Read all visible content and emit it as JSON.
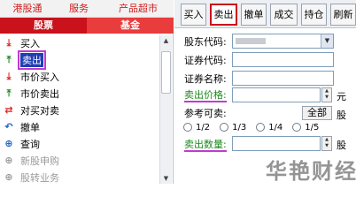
{
  "top_tabs": [
    "港股通",
    "服务",
    "产品超市"
  ],
  "market_tabs": [
    {
      "label": "股票",
      "active": true
    },
    {
      "label": "基金",
      "active": false
    }
  ],
  "menu": [
    {
      "label": "买入",
      "icon": "download-arrow-icon",
      "glyph": "⤓",
      "color": "red",
      "selected": false,
      "disabled": false
    },
    {
      "label": "卖出",
      "icon": "upload-arrow-icon",
      "glyph": "⤒",
      "color": "green",
      "selected": true,
      "disabled": false
    },
    {
      "label": "市价买入",
      "icon": "download-arrow-icon",
      "glyph": "⤓",
      "color": "red",
      "selected": false,
      "disabled": false
    },
    {
      "label": "市价卖出",
      "icon": "upload-arrow-icon",
      "glyph": "⤒",
      "color": "green",
      "selected": false,
      "disabled": false
    },
    {
      "label": "对买对卖",
      "icon": "swap-arrows-icon",
      "glyph": "⇄",
      "color": "red",
      "selected": false,
      "disabled": false
    },
    {
      "label": "撤单",
      "icon": "undo-arrow-icon",
      "glyph": "↶",
      "color": "blue",
      "selected": false,
      "disabled": false
    },
    {
      "label": "查询",
      "icon": "plus-circle-icon",
      "glyph": "⊕",
      "color": "blue",
      "selected": false,
      "disabled": false
    },
    {
      "label": "新股申购",
      "icon": "plus-circle-icon",
      "glyph": "⊕",
      "color": "gray",
      "selected": false,
      "disabled": true
    },
    {
      "label": "股转业务",
      "icon": "plus-circle-icon",
      "glyph": "⊕",
      "color": "gray",
      "selected": false,
      "disabled": true
    }
  ],
  "right_tabs": [
    {
      "label": "买入",
      "active": false
    },
    {
      "label": "卖出",
      "active": true
    },
    {
      "label": "撤单",
      "active": false
    },
    {
      "label": "成交",
      "active": false
    },
    {
      "label": "持仓",
      "active": false
    },
    {
      "label": "刷新",
      "active": false
    }
  ],
  "form": {
    "account_label": "股东代码:",
    "code_label": "证券代码:",
    "name_label": "证券名称:",
    "price_label": "卖出价格:",
    "price_unit": "元",
    "sellable_label": "参考可卖:",
    "all_button": "全部",
    "sellable_unit": "股",
    "ratios": [
      "1/2",
      "1/3",
      "1/4",
      "1/5"
    ],
    "qty_label": "卖出数量:",
    "qty_unit": "股"
  },
  "watermark": "华艳财经",
  "colors": {
    "accent_red": "#c9121b",
    "highlight_purple": "#c23ad0",
    "label_green": "#1a8a1a",
    "selection_blue": "#1f3fb3"
  }
}
